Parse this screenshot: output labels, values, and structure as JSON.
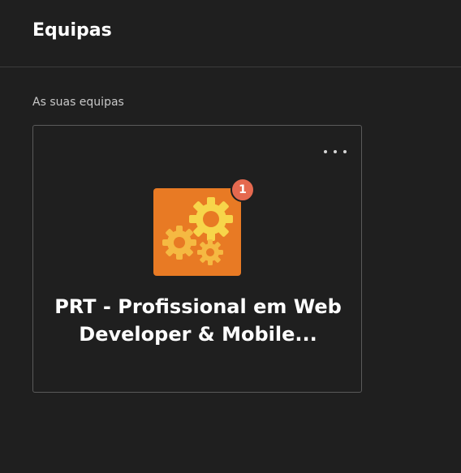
{
  "header": {
    "title": "Equipas"
  },
  "teams_section": {
    "label": "As suas equipas",
    "teams": [
      {
        "name_line1": "PRT - Profissional em Web",
        "name_line2": "Developer & Mobile...",
        "notification_count": "1",
        "avatar_icon": "gears-icon",
        "avatar_color": "#e87a24",
        "badge_color": "#e5694f"
      }
    ]
  },
  "colors": {
    "background": "#1f1f1f",
    "card_border": "#5a5a5a",
    "text_primary": "#ffffff",
    "text_secondary": "#c8c8c8"
  }
}
